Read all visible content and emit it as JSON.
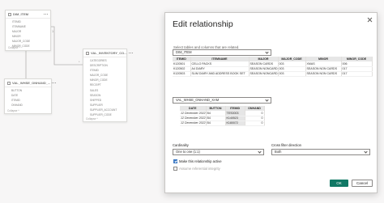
{
  "model": {
    "tables": [
      {
        "name": "DIM_ITEM",
        "fields": [
          "ITEMID",
          "ITEMNAME",
          "MAJOR",
          "MINOR",
          "MAJOR_CODE",
          "MINOR_CODE",
          "PRODUCTLINE",
          "SUBCATEGORY"
        ],
        "footer": "Collapse ^"
      },
      {
        "name": "VAL_WHSE_ONHAND_...",
        "fields": [
          "BUTTON",
          "DATE",
          "ITEMID",
          "ONHAND"
        ],
        "footer": "Collapse ^"
      },
      {
        "name": "VAL_INVENTORY_CO...",
        "fields": [
          "CATEGORIES",
          "DESCRIPTION",
          "ITEMID",
          "MAJOR_CODE",
          "MINOR_CODE",
          "RECEIPT",
          "SALES",
          "SEASON",
          "SHIPPED",
          "SUPPLIER",
          "SUPPLIER_ACCOUNT",
          "SUPPLIER_CODE"
        ],
        "footer": "Collapse ^"
      }
    ],
    "cardinality_marks": {
      "one": "1",
      "many": "*"
    }
  },
  "dialog": {
    "title": "Edit relationship",
    "subtitle": "Select tables and columns that are related.",
    "table1": {
      "selected": "DIM_ITEM",
      "columns": [
        "ITEMID",
        "ITEMNAME",
        "MAJOR",
        "MAJOR_CODE",
        "MINOR",
        "MINOR_CODE"
      ],
      "rows": [
        [
          "K120501",
          "CELLO PACKS",
          "SEASON CARDS",
          "003",
          "XMAS",
          "006"
        ],
        [
          "K120502",
          "A4 DIARY",
          "SEASON NONCARD",
          "003",
          "SEASON NON CARDS",
          "017"
        ],
        [
          "K120503",
          "SLIM DIARY AND ADDRESS BOOK SET",
          "SEASON NONCARD",
          "003",
          "SEASON NON CARDS",
          "017"
        ]
      ]
    },
    "table2": {
      "selected": "VAL_WHSE_ONHAND_XAM",
      "columns": [
        "DATE",
        "BUTTON",
        "ITEMID",
        "ONHAND"
      ],
      "rows": [
        [
          "12 December 2022",
          "B4",
          "TES0003",
          "0"
        ],
        [
          "12 December 2022",
          "B4",
          "K140523",
          "0"
        ],
        [
          "12 December 2022",
          "B4",
          "K180072",
          "0"
        ]
      ]
    },
    "cardinality": {
      "label": "Cardinality",
      "value": "One to one (1:1)"
    },
    "cross_filter": {
      "label": "Cross filter direction",
      "value": "Both"
    },
    "active": {
      "label": "Make this relationship active",
      "checked": true
    },
    "integrity": {
      "label": "Assume referential integrity",
      "checked": false,
      "disabled": true
    },
    "ok_label": "OK",
    "cancel_label": "Cancel"
  }
}
